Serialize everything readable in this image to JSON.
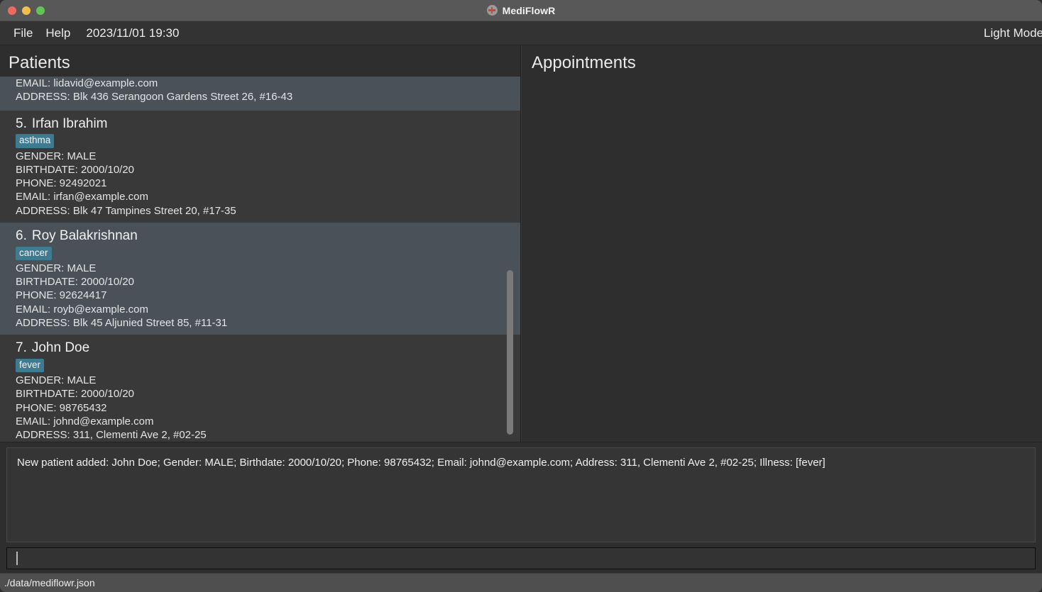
{
  "window": {
    "title": "MediFlowR",
    "app_icon": "medical-cross-icon",
    "traffic_lights": [
      {
        "name": "close",
        "color": "#ec6a5f"
      },
      {
        "name": "minimize",
        "color": "#f4bd4f"
      },
      {
        "name": "maximize",
        "color": "#61c555"
      }
    ]
  },
  "menubar": {
    "file_label": "File",
    "help_label": "Help",
    "clock": "2023/11/01 19:30",
    "theme_toggle_label": "Light Mode"
  },
  "panels": {
    "patients": {
      "title": "Patients",
      "field_labels": {
        "gender": "GENDER:",
        "birthdate": "BIRTHDATE:",
        "phone": "PHONE:",
        "email": "EMAIL:",
        "address": "ADDRESS:"
      },
      "items": [
        {
          "clipped": true,
          "highlighted": true,
          "index": "",
          "name": "",
          "tags": [],
          "gender": "",
          "birthdate": "",
          "phone": "",
          "email": "EMAIL: lidavid@example.com",
          "address": "ADDRESS: Blk 436 Serangoon Gardens Street 26, #16-43"
        },
        {
          "clipped": false,
          "highlighted": false,
          "index": "5.",
          "name": "Irfan Ibrahim",
          "tags": [
            "asthma"
          ],
          "gender": "GENDER: MALE",
          "birthdate": "BIRTHDATE: 2000/10/20",
          "phone": "PHONE: 92492021",
          "email": "EMAIL: irfan@example.com",
          "address": "ADDRESS: Blk 47 Tampines Street 20, #17-35"
        },
        {
          "clipped": false,
          "highlighted": true,
          "index": "6.",
          "name": "Roy Balakrishnan",
          "tags": [
            "cancer"
          ],
          "gender": "GENDER: MALE",
          "birthdate": "BIRTHDATE: 2000/10/20",
          "phone": "PHONE: 92624417",
          "email": "EMAIL: royb@example.com",
          "address": "ADDRESS: Blk 45 Aljunied Street 85, #11-31"
        },
        {
          "clipped": false,
          "highlighted": false,
          "index": "7.",
          "name": "John Doe",
          "tags": [
            "fever"
          ],
          "gender": "GENDER: MALE",
          "birthdate": "BIRTHDATE: 2000/10/20",
          "phone": "PHONE: 98765432",
          "email": "EMAIL: johnd@example.com",
          "address": "ADDRESS: 311, Clementi Ave 2, #02-25"
        }
      ]
    },
    "appointments": {
      "title": "Appointments",
      "items": []
    }
  },
  "result": {
    "message": "New patient added: John Doe; Gender: MALE; Birthdate: 2000/10/20; Phone: 98765432; Email: johnd@example.com; Address: 311, Clementi Ave 2, #02-25; Illness: [fever]"
  },
  "command": {
    "value": "",
    "placeholder": ""
  },
  "statusbar": {
    "save_location": "./data/mediflowr.json"
  },
  "colors": {
    "tag_background": "#3e7b91",
    "card_background": "#393939",
    "card_background_alt": "#4a5257",
    "window_background": "#2e2e2e",
    "titlebar": "#585858",
    "statusbar": "#4f4f4f",
    "scrollbar_thumb": "#7a7a7a"
  }
}
